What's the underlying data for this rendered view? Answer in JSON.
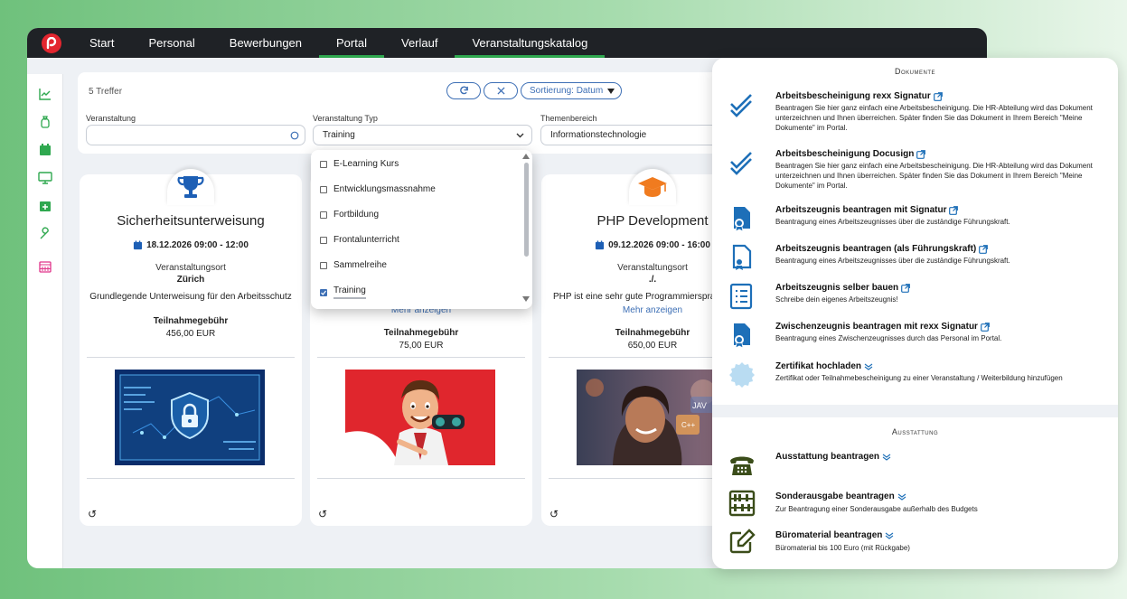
{
  "nav": {
    "items": [
      "Start",
      "Personal",
      "Bewerbungen",
      "Portal",
      "Verlauf",
      "Veranstaltungskatalog"
    ]
  },
  "filter": {
    "hits": "5 Treffer",
    "sort_label": "Sortierung: Datum",
    "refresh_icon": "refresh-icon",
    "clear_icon": "close-icon",
    "fields": [
      {
        "label": "Veranstaltung",
        "value": ""
      },
      {
        "label": "Veranstaltung Typ",
        "value": "Training"
      },
      {
        "label": "Themenbereich",
        "value": "Informationstechnologie"
      }
    ]
  },
  "dropdown": {
    "options": [
      {
        "label": "E-Learning Kurs",
        "checked": false
      },
      {
        "label": "Entwicklungsmassnahme",
        "checked": false
      },
      {
        "label": "Fortbildung",
        "checked": false
      },
      {
        "label": "Frontalunterricht",
        "checked": false
      },
      {
        "label": "Sammelreihe",
        "checked": false
      },
      {
        "label": "Training",
        "checked": true
      }
    ]
  },
  "cards": [
    {
      "title": "Sicherheitsunterweisung",
      "date": "18.12.2026 09:00 - 12:00",
      "location_label": "Veranstaltungsort",
      "location": "Zürich",
      "desc": "Grundlegende Unterweisung für den Arbeitsschutz",
      "more": "",
      "fee_label": "Teilnahmegebühr",
      "fee": "456,00 EUR",
      "icon": "trophy-icon"
    },
    {
      "title": "",
      "date": "",
      "location_label": "",
      "location": "",
      "desc": "",
      "more": "Mehr anzeigen",
      "fee_label": "Teilnahmegebühr",
      "fee": "75,00 EUR",
      "icon": ""
    },
    {
      "title": "PHP Development",
      "date": "09.12.2026 09:00 - 16:00",
      "location_label": "Veranstaltungsort",
      "location": "./.",
      "desc": "PHP ist eine sehr gute Programmiersprache",
      "more": "Mehr anzeigen",
      "fee_label": "Teilnahmegebühr",
      "fee": "650,00 EUR",
      "icon": "graduation-cap-icon"
    }
  ],
  "panel": {
    "section_documents": "Dokumente",
    "section_equipment": "Ausstattung",
    "documents": [
      {
        "name": "Arbeitsbescheinigung rexx Signatur",
        "desc": "Beantragen Sie hier ganz einfach eine Arbeitsbescheinigung. Die HR-Abteilung wird das Dokument unterzeichnen und Ihnen überreichen. Später finden Sie das Dokument in Ihrem Bereich \"Meine Dokumente\" im Portal.",
        "icon": "double-check-icon",
        "link_icon": "external-link-icon"
      },
      {
        "name": "Arbeitsbescheinigung Docusign",
        "desc": "Beantragen Sie hier ganz einfach eine Arbeitsbescheinigung. Die HR-Abteilung wird das Dokument unterzeichnen und Ihnen überreichen. Später finden Sie das Dokument in Ihrem Bereich \"Meine Dokumente\" im Portal.",
        "icon": "double-check-icon",
        "link_icon": "external-link-icon"
      },
      {
        "name": "Arbeitszeugnis beantragen mit Signatur",
        "desc": "Beantragung eines Arbeitszeugnisses über die zuständige Führungskraft.",
        "icon": "certificate-file-icon",
        "link_icon": "external-link-icon"
      },
      {
        "name": "Arbeitszeugnis beantragen (als Führungskraft)",
        "desc": "Beantragung eines Arbeitszeugnisses über die zuständige Führungskraft.",
        "icon": "certificate-file-icon",
        "link_icon": "external-link-icon"
      },
      {
        "name": "Arbeitszeugnis selber bauen",
        "desc": "Schreibe dein eigenes Arbeitszeugnis!",
        "icon": "checklist-icon",
        "link_icon": "external-link-icon"
      },
      {
        "name": "Zwischenzeugnis beantragen mit rexx Signatur",
        "desc": "Beantragung eines Zwischenzeugnisses durch das Personal im Portal.",
        "icon": "certificate-file-icon",
        "link_icon": "external-link-icon"
      },
      {
        "name": "Zertifikat hochladen",
        "desc": "Zertifikat oder Teilnahmebescheinigung zu einer Veranstaltung / Weiterbildung hinzufügen",
        "icon": "seal-badge-icon",
        "link_icon": "chevron-down-icon"
      }
    ],
    "equipment": [
      {
        "name": "Ausstattung beantragen",
        "desc": "",
        "icon": "phone-icon"
      },
      {
        "name": "Sonderausgabe beantragen",
        "desc": "Zur Beantragung einer Sonderausgabe außerhalb des Budgets",
        "icon": "abacus-icon"
      },
      {
        "name": "Büromaterial beantragen",
        "desc": "Büromaterial bis 100 Euro (mit Rückgabe)",
        "icon": "pencil-edit-icon"
      }
    ]
  },
  "colors": {
    "accent": "#2fa84f",
    "link": "#3d6fb5",
    "topbar": "#1f2226",
    "doc_icon": "#1d6fb8",
    "equip_icon": "#3b4d1a"
  }
}
